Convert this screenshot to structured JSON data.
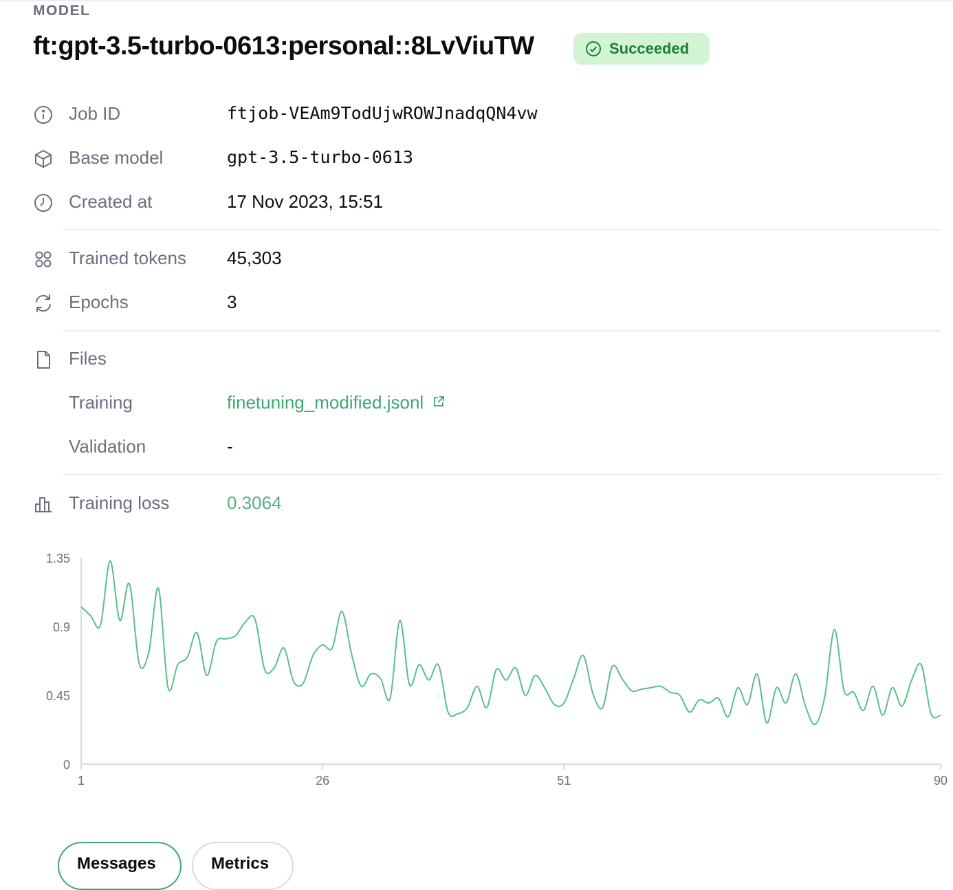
{
  "header": {
    "eyebrow": "MODEL",
    "title": "ft:gpt-3.5-turbo-0613:personal::8LvViuTW",
    "status": "Succeeded",
    "status_color": "#1a7f37",
    "status_bg": "#d2f4d3"
  },
  "details": {
    "job_id": {
      "label": "Job ID",
      "value": "ftjob-VEAm9TodUjwROWJnadqQN4vw",
      "icon": "info-icon"
    },
    "base_model": {
      "label": "Base model",
      "value": "gpt-3.5-turbo-0613",
      "icon": "cube-icon"
    },
    "created_at": {
      "label": "Created at",
      "value": "17 Nov 2023, 15:51",
      "icon": "clock-icon"
    },
    "trained_tokens": {
      "label": "Trained tokens",
      "value": "45,303",
      "icon": "grid-dots-icon"
    },
    "epochs": {
      "label": "Epochs",
      "value": "3",
      "icon": "refresh-icon"
    },
    "files": {
      "label": "Files",
      "icon": "file-icon"
    },
    "training_file": {
      "label": "Training",
      "value": "finetuning_modified.jsonl",
      "icon": "external-link-icon"
    },
    "validation_file": {
      "label": "Validation",
      "value": "-"
    },
    "training_loss": {
      "label": "Training loss",
      "value": "0.3064",
      "icon": "bar-chart-icon"
    }
  },
  "colors": {
    "accent": "#3ca96f",
    "line": "#5bbf86",
    "muted": "#6e6e80"
  },
  "chart_data": {
    "type": "line",
    "title": "",
    "xlabel": "",
    "ylabel": "",
    "x_ticks": [
      1,
      26,
      51,
      90
    ],
    "y_ticks": [
      0,
      0.45,
      0.9,
      1.35
    ],
    "xlim": [
      1,
      90
    ],
    "ylim": [
      0,
      1.35
    ],
    "grid": false,
    "series": [
      {
        "name": "",
        "color": "#5bbf86",
        "x": [
          1,
          2,
          3,
          4,
          5,
          6,
          7,
          8,
          9,
          10,
          11,
          12,
          13,
          14,
          15,
          16,
          17,
          18,
          19,
          20,
          21,
          22,
          23,
          24,
          25,
          26,
          27,
          28,
          29,
          30,
          31,
          32,
          33,
          34,
          35,
          36,
          37,
          38,
          39,
          40,
          41,
          42,
          43,
          44,
          45,
          46,
          47,
          48,
          49,
          50,
          51,
          52,
          53,
          54,
          55,
          56,
          57,
          58,
          59,
          60,
          61,
          62,
          63,
          64,
          65,
          66,
          67,
          68,
          69,
          70,
          71,
          72,
          73,
          74,
          75,
          76,
          77,
          78,
          79,
          80,
          81,
          82,
          83,
          84,
          85,
          86,
          87,
          88,
          89,
          90
        ],
        "y": [
          1.03,
          0.97,
          0.91,
          1.33,
          0.94,
          1.18,
          0.66,
          0.73,
          1.15,
          0.5,
          0.65,
          0.7,
          0.86,
          0.58,
          0.8,
          0.82,
          0.84,
          0.93,
          0.95,
          0.62,
          0.63,
          0.76,
          0.54,
          0.53,
          0.71,
          0.78,
          0.76,
          1.0,
          0.72,
          0.51,
          0.59,
          0.56,
          0.43,
          0.94,
          0.52,
          0.65,
          0.55,
          0.65,
          0.34,
          0.33,
          0.37,
          0.51,
          0.37,
          0.62,
          0.55,
          0.63,
          0.45,
          0.58,
          0.5,
          0.39,
          0.4,
          0.56,
          0.71,
          0.46,
          0.37,
          0.64,
          0.56,
          0.48,
          0.49,
          0.5,
          0.51,
          0.47,
          0.45,
          0.34,
          0.42,
          0.4,
          0.43,
          0.31,
          0.5,
          0.39,
          0.59,
          0.27,
          0.5,
          0.4,
          0.59,
          0.38,
          0.26,
          0.44,
          0.88,
          0.48,
          0.47,
          0.35,
          0.51,
          0.32,
          0.5,
          0.38,
          0.55,
          0.65,
          0.33,
          0.32
        ]
      }
    ]
  },
  "tabs": {
    "first": "Messages",
    "second": "Metrics"
  }
}
